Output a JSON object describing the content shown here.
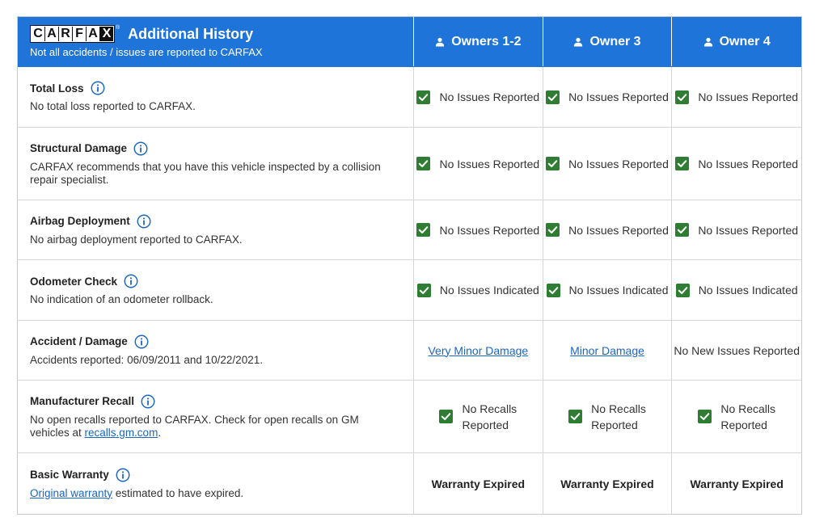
{
  "header": {
    "logo_letters": [
      "C",
      "A",
      "R",
      "F",
      "A",
      "X"
    ],
    "title": "Additional History",
    "subtitle": "Not all accidents / issues are reported to CARFAX",
    "owners": [
      "Owners 1-2",
      "Owner 3",
      "Owner 4"
    ]
  },
  "rows": [
    {
      "label": "Total Loss",
      "desc": "No total loss reported to CARFAX.",
      "cells": [
        "No Issues Reported",
        "No Issues Reported",
        "No Issues Reported"
      ]
    },
    {
      "label": "Structural Damage",
      "desc": "CARFAX recommends that you have this vehicle inspected by a collision repair specialist.",
      "cells": [
        "No Issues Reported",
        "No Issues Reported",
        "No Issues Reported"
      ]
    },
    {
      "label": "Airbag Deployment",
      "desc": "No airbag deployment reported to CARFAX.",
      "cells": [
        "No Issues Reported",
        "No Issues Reported",
        "No Issues Reported"
      ]
    },
    {
      "label": "Odometer Check",
      "desc": "No indication of an odometer rollback.",
      "cells": [
        "No Issues Indicated",
        "No Issues Indicated",
        "No Issues Indicated"
      ]
    },
    {
      "label": "Accident / Damage",
      "desc": "Accidents reported: 06/09/2011 and 10/22/2021.",
      "cells": [
        "Very Minor Damage",
        "Minor Damage",
        "No New Issues Reported"
      ]
    },
    {
      "label": "Manufacturer Recall",
      "desc_pre": "No open recalls reported to CARFAX. Check for open recalls on GM vehicles at ",
      "desc_link": "recalls.gm.com",
      "desc_post": ".",
      "cells_l1": [
        "No Recalls",
        "No Recalls",
        "No Recalls"
      ],
      "cells_l2": [
        "Reported",
        "Reported",
        "Reported"
      ]
    },
    {
      "label": "Basic Warranty",
      "desc_link": "Original warranty",
      "desc_post": " estimated to have expired.",
      "cells": [
        "Warranty Expired",
        "Warranty Expired",
        "Warranty Expired"
      ]
    }
  ],
  "colors": {
    "header_bg": "#1e74d8",
    "check_green": "#2e7d32",
    "link_blue": "#1a66c2"
  }
}
